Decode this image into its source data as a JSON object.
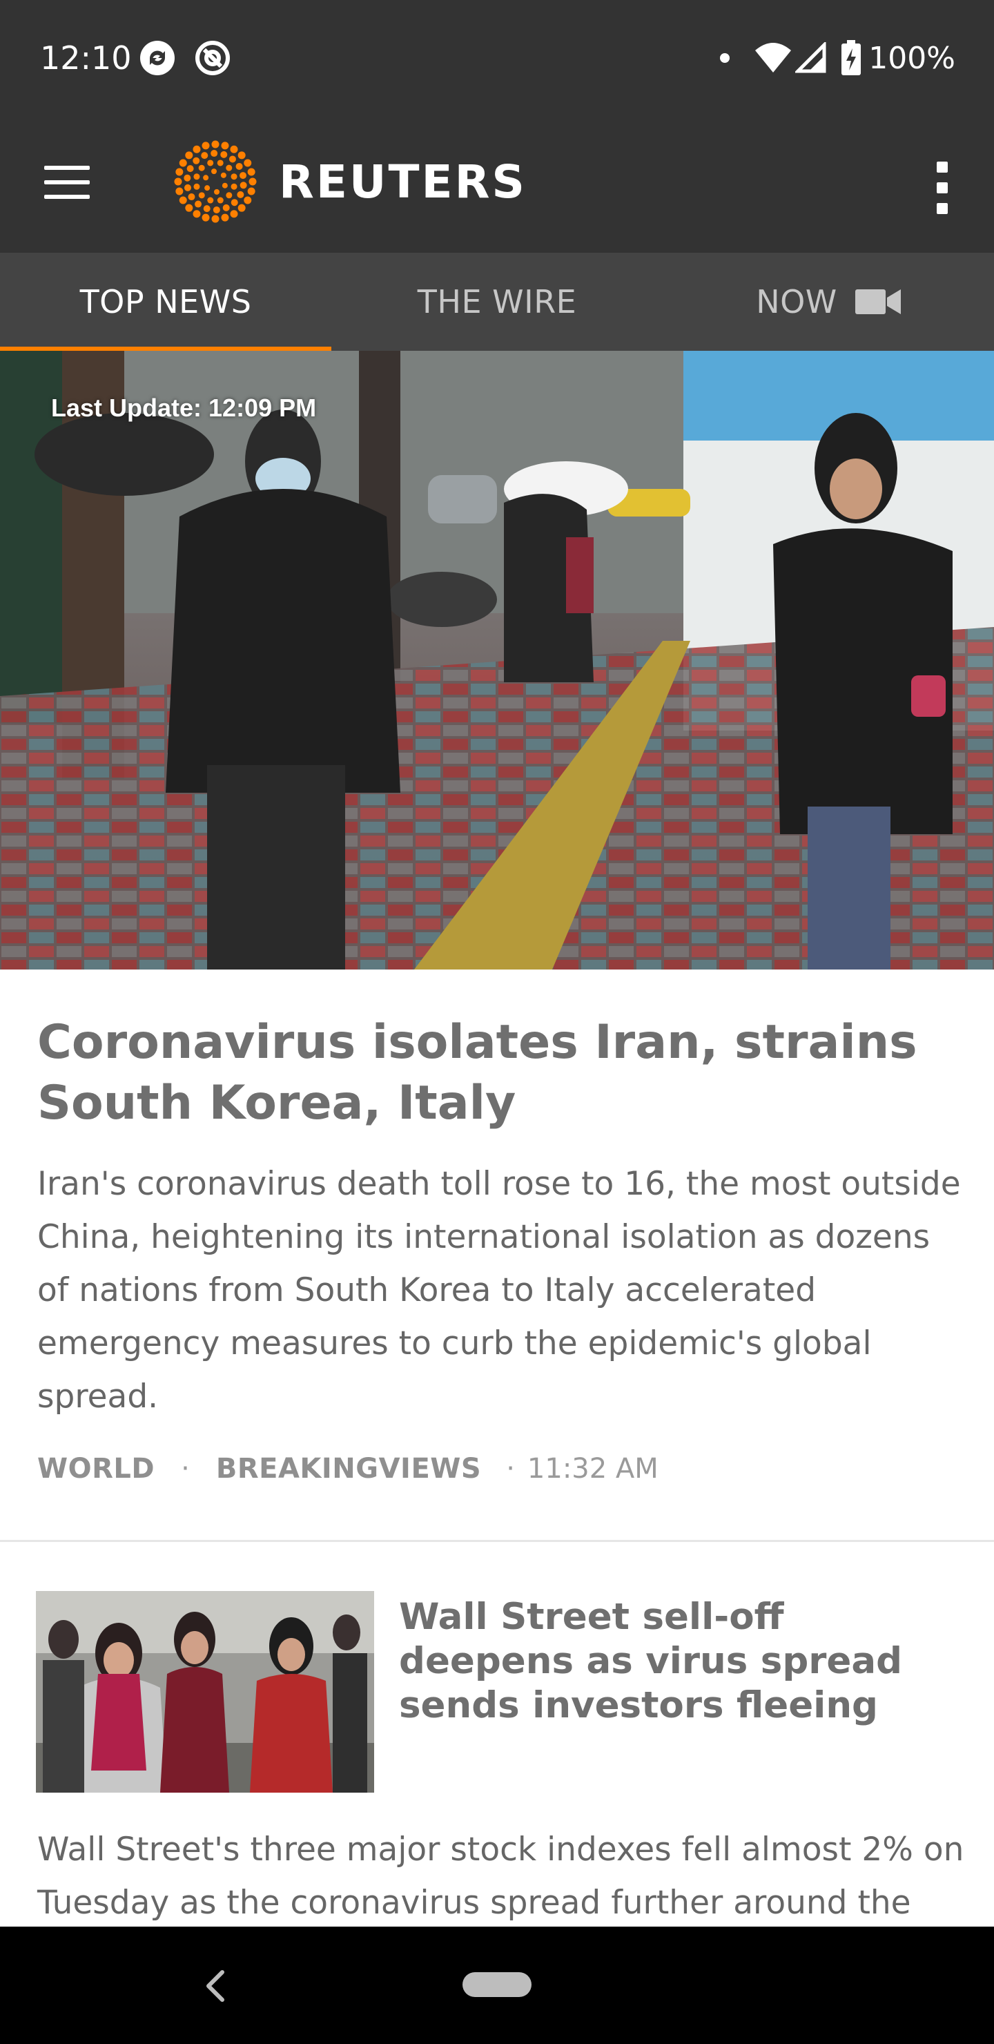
{
  "status_bar": {
    "time": "12:10",
    "battery": "100%",
    "icons": [
      "sync-icon",
      "at-sign-icon",
      "notification-dot-icon",
      "wifi-icon",
      "signal-icon",
      "battery-charging-icon"
    ]
  },
  "app_bar": {
    "logo_text": "REUTERS",
    "menu_icon": "hamburger-menu-icon",
    "overflow_icon": "more-vertical-icon",
    "brand_color": "#ff8000",
    "background": "#333333"
  },
  "tabs": [
    {
      "label": "TOP NEWS",
      "active": true
    },
    {
      "label": "THE WIRE",
      "active": false
    },
    {
      "label": "NOW",
      "active": false,
      "icon": "video-camera-icon"
    }
  ],
  "hero": {
    "last_update": "Last Update: 12:09 PM"
  },
  "main_story": {
    "headline": "Coronavirus isolates Iran, strains South Korea, Italy",
    "summary": "Iran's coronavirus death toll rose to 16, the most outside China, heightening its international isolation as dozens of nations from South Korea to Italy accelerated emergency measures to curb the epidemic's global spread.",
    "tags": [
      "WORLD",
      "BREAKINGVIEWS"
    ],
    "separator": "·",
    "time": "11:32 AM"
  },
  "second_story": {
    "headline": "Wall Street sell-off deepens as virus spread sends investors fleeing",
    "summary": "Wall Street's three major stock indexes fell almost 2% on Tuesday as the coronavirus spread further around the"
  },
  "nav_bar": {
    "back_icon": "back-chevron-icon",
    "home_icon": "home-pill-icon"
  }
}
